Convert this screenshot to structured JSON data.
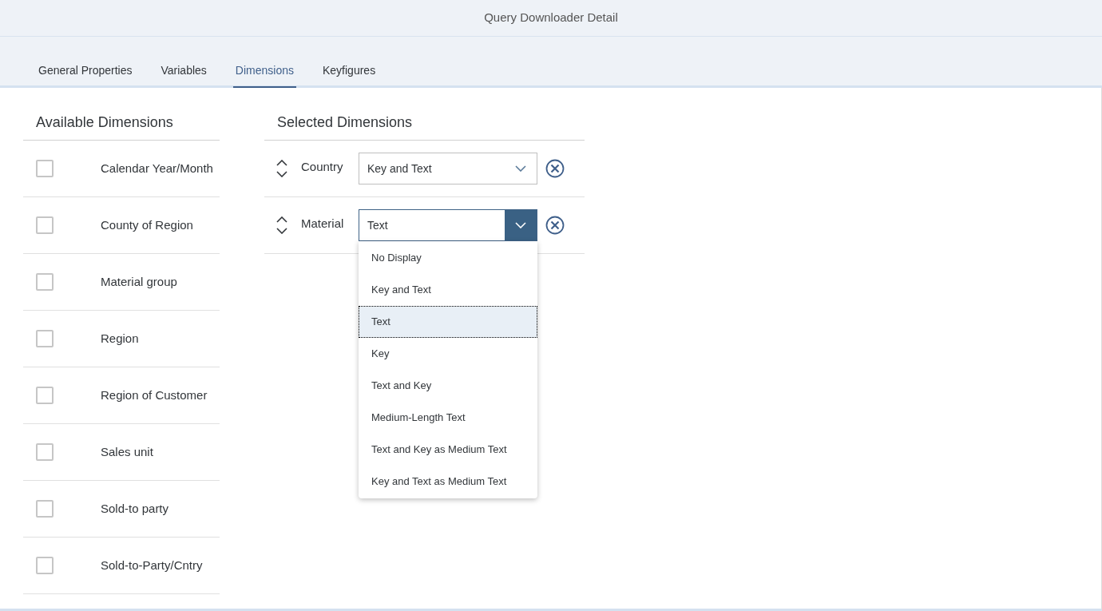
{
  "window": {
    "title": "Query Downloader Detail"
  },
  "tabs": [
    {
      "label": "General Properties",
      "selected": false
    },
    {
      "label": "Variables",
      "selected": false
    },
    {
      "label": "Dimensions",
      "selected": true
    },
    {
      "label": "Keyfigures",
      "selected": false
    }
  ],
  "available": {
    "title": "Available Dimensions",
    "items": [
      {
        "label": "Calendar Year/Month",
        "checked": false
      },
      {
        "label": "County of Region",
        "checked": false
      },
      {
        "label": "Material group",
        "checked": false
      },
      {
        "label": "Region",
        "checked": false
      },
      {
        "label": "Region of Customer",
        "checked": false
      },
      {
        "label": "Sales unit",
        "checked": false
      },
      {
        "label": "Sold-to party",
        "checked": false
      },
      {
        "label": "Sold-to-Party/Cntry",
        "checked": false
      }
    ]
  },
  "selected": {
    "title": "Selected Dimensions",
    "items": [
      {
        "label": "Country",
        "value": "Key and Text",
        "expanded": false
      },
      {
        "label": "Material",
        "value": "Text",
        "expanded": true,
        "options": [
          {
            "label": "No Display",
            "selected": false
          },
          {
            "label": "Key and Text",
            "selected": false
          },
          {
            "label": "Text",
            "selected": true
          },
          {
            "label": "Key",
            "selected": false
          },
          {
            "label": "Text and Key",
            "selected": false
          },
          {
            "label": "Medium-Length Text",
            "selected": false
          },
          {
            "label": "Text and Key as Medium Text",
            "selected": false
          },
          {
            "label": "Key and Text as Medium Text",
            "selected": false
          }
        ]
      }
    ]
  }
}
